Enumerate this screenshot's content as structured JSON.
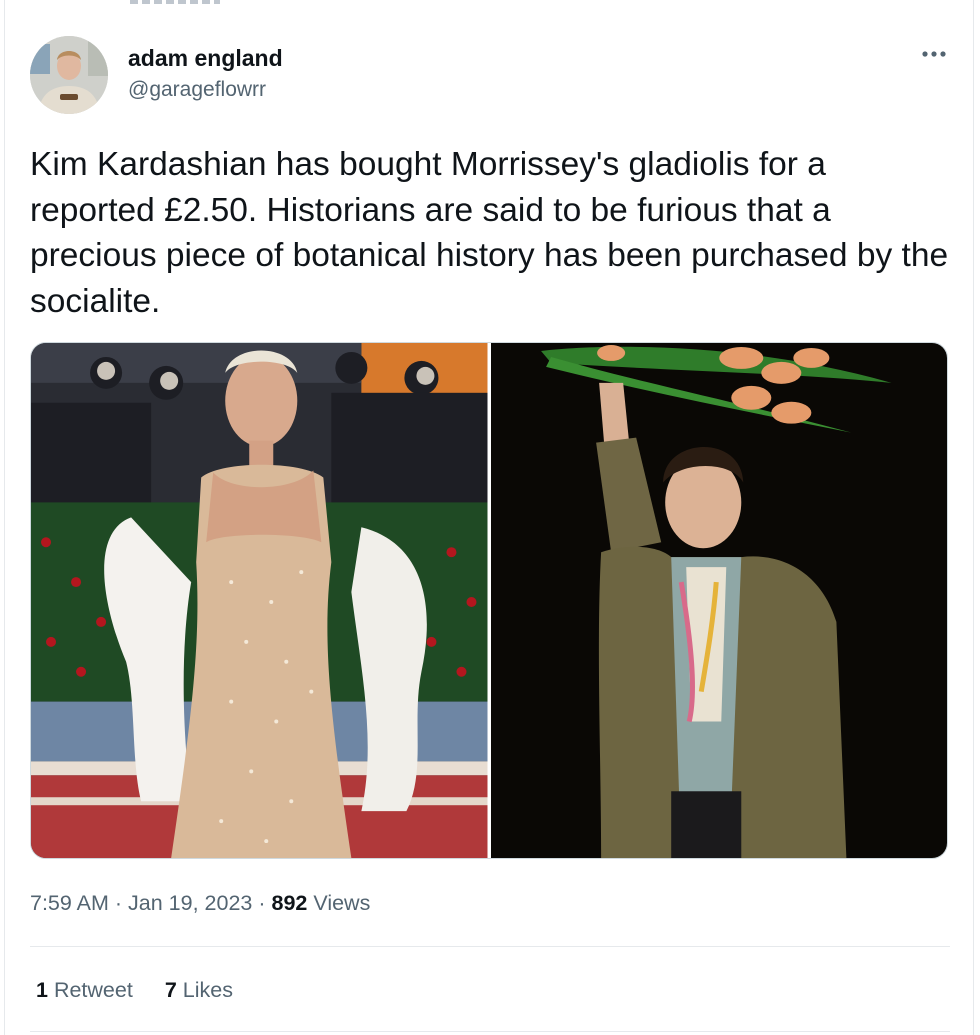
{
  "tweet": {
    "author": {
      "display_name": "adam england",
      "handle": "@garageflowrr",
      "avatar_icon": "profile-photo"
    },
    "more_icon": "ellipsis-icon",
    "text": "Kim Kardashian has bought Morrissey's gladiolis for a reported £2.50. Historians are said to be furious that a precious piece of botanical history has been purchased by the socialite.",
    "media": [
      {
        "icon": "photo-woman-in-crystal-gown-on-red-carpet"
      },
      {
        "icon": "photo-man-holding-gladioli-overhead"
      }
    ],
    "meta": {
      "time": "7:59 AM",
      "separator": "·",
      "date": "Jan 19, 2023",
      "views_count": "892",
      "views_label": "Views"
    },
    "stats": {
      "retweets_count": "1",
      "retweets_label": "Retweet",
      "likes_count": "7",
      "likes_label": "Likes"
    }
  }
}
